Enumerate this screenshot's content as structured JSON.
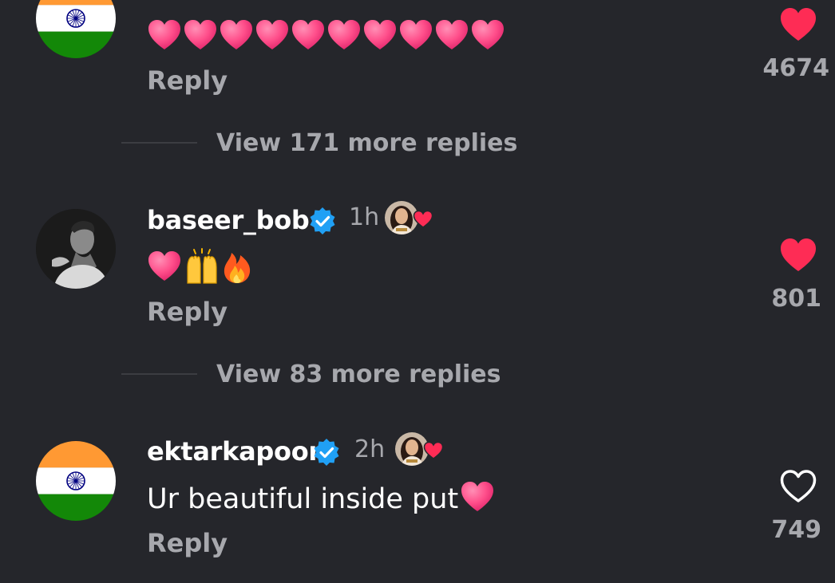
{
  "colors": {
    "background": "#25262b",
    "muted_text": "#a7a8ad",
    "like_red": "#fe2c55",
    "verified_blue": "#20a0f5",
    "emoji_pink": "#ff4f8b"
  },
  "comments": [
    {
      "username": "",
      "time": "",
      "avatar_icon": "india-flag-icon",
      "text_emoji": [
        "pink-heart-emoji",
        "pink-heart-emoji",
        "pink-heart-emoji",
        "pink-heart-emoji",
        "pink-heart-emoji",
        "pink-heart-emoji",
        "pink-heart-emoji",
        "pink-heart-emoji",
        "pink-heart-emoji",
        "pink-heart-emoji"
      ],
      "reply_label": "Reply",
      "like_count": "4674",
      "liked": true,
      "view_more_label": "View 171 more replies"
    },
    {
      "username": "baseer_bob",
      "time": "1h",
      "avatar_icon": "profile-photo",
      "text_emoji": [
        "pink-heart-emoji",
        "raising-hands-emoji",
        "fire-emoji"
      ],
      "reply_label": "Reply",
      "like_count": "801",
      "liked": true,
      "view_more_label": "View 83 more replies"
    },
    {
      "username": "ektarkapoor",
      "time": "2h",
      "avatar_icon": "india-flag-icon",
      "text": "Ur beautiful inside put",
      "reply_label": "Reply",
      "like_count": "749",
      "liked": false
    }
  ]
}
